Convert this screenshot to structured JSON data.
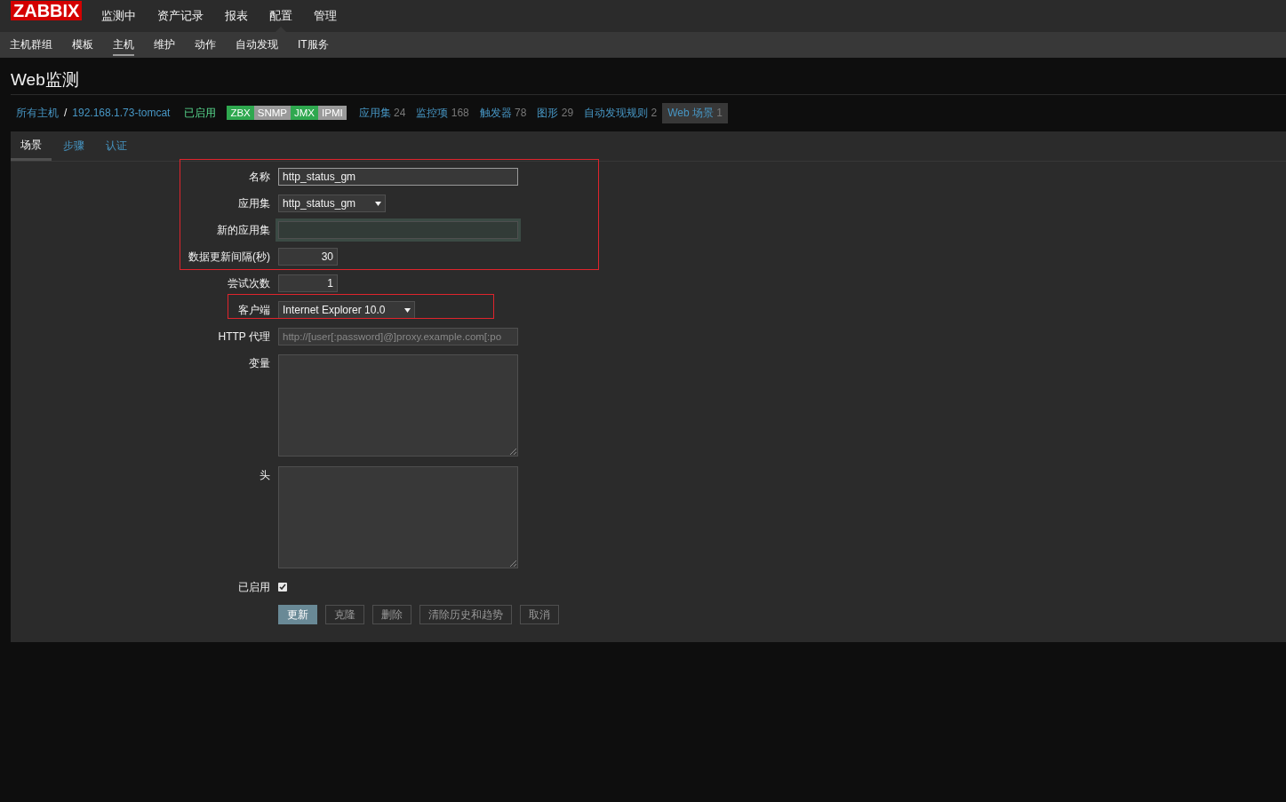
{
  "logo": "ZABBIX",
  "main_menu": [
    {
      "label": "监测中",
      "selected": false
    },
    {
      "label": "资产记录",
      "selected": false
    },
    {
      "label": "报表",
      "selected": false
    },
    {
      "label": "配置",
      "selected": true
    },
    {
      "label": "管理",
      "selected": false
    }
  ],
  "sub_menu": [
    {
      "label": "主机群组",
      "selected": false
    },
    {
      "label": "模板",
      "selected": false
    },
    {
      "label": "主机",
      "selected": true
    },
    {
      "label": "维护",
      "selected": false
    },
    {
      "label": "动作",
      "selected": false
    },
    {
      "label": "自动发现",
      "selected": false
    },
    {
      "label": "IT服务",
      "selected": false
    }
  ],
  "page_title": "Web监测",
  "breadcrumb": {
    "root": "所有主机",
    "separator": "/",
    "host": "192.168.1.73-tomcat",
    "status": "已启用"
  },
  "availability": [
    {
      "label": "ZBX",
      "color": "#2fa84f"
    },
    {
      "label": "SNMP",
      "color": "#9a9a9a"
    },
    {
      "label": "JMX",
      "color": "#2fa84f"
    },
    {
      "label": "IPMI",
      "color": "#9a9a9a"
    }
  ],
  "host_links": [
    {
      "label": "应用集",
      "count": "24",
      "selected": false
    },
    {
      "label": "监控项",
      "count": "168",
      "selected": false
    },
    {
      "label": "触发器",
      "count": "78",
      "selected": false
    },
    {
      "label": "图形",
      "count": "29",
      "selected": false
    },
    {
      "label": "自动发现规则",
      "count": "2",
      "selected": false
    },
    {
      "label": "Web 场景",
      "count": "1",
      "selected": true
    }
  ],
  "tabs": [
    {
      "label": "场景",
      "selected": true
    },
    {
      "label": "步骤",
      "selected": false
    },
    {
      "label": "认证",
      "selected": false
    }
  ],
  "form": [
    {
      "kind": "text",
      "label": "名称",
      "value": "http_status_gm"
    },
    {
      "kind": "select",
      "label": "应用集",
      "value": "http_status_gm"
    },
    {
      "kind": "text",
      "label": "新的应用集",
      "focused": true
    },
    {
      "kind": "number",
      "label": "数据更新间隔(秒)",
      "value": "30"
    },
    {
      "kind": "number",
      "label": "尝试次数",
      "value": "1"
    },
    {
      "kind": "select",
      "label": "客户端",
      "value": "Internet Explorer 10.0"
    },
    {
      "kind": "placeholder",
      "label": "HTTP 代理",
      "placeholder": "http://[user[:password]@]proxy.example.com[:po"
    },
    {
      "kind": "textarea",
      "label": "变量"
    },
    {
      "kind": "textarea",
      "label": "头"
    },
    {
      "kind": "checkbox",
      "label": "已启用",
      "checked": true
    }
  ],
  "buttons": [
    {
      "label": "更新",
      "primary": true
    },
    {
      "label": "克隆",
      "primary": false
    },
    {
      "label": "删除",
      "primary": false
    },
    {
      "label": "清除历史和趋势",
      "primary": false
    },
    {
      "label": "取消",
      "primary": false
    }
  ]
}
